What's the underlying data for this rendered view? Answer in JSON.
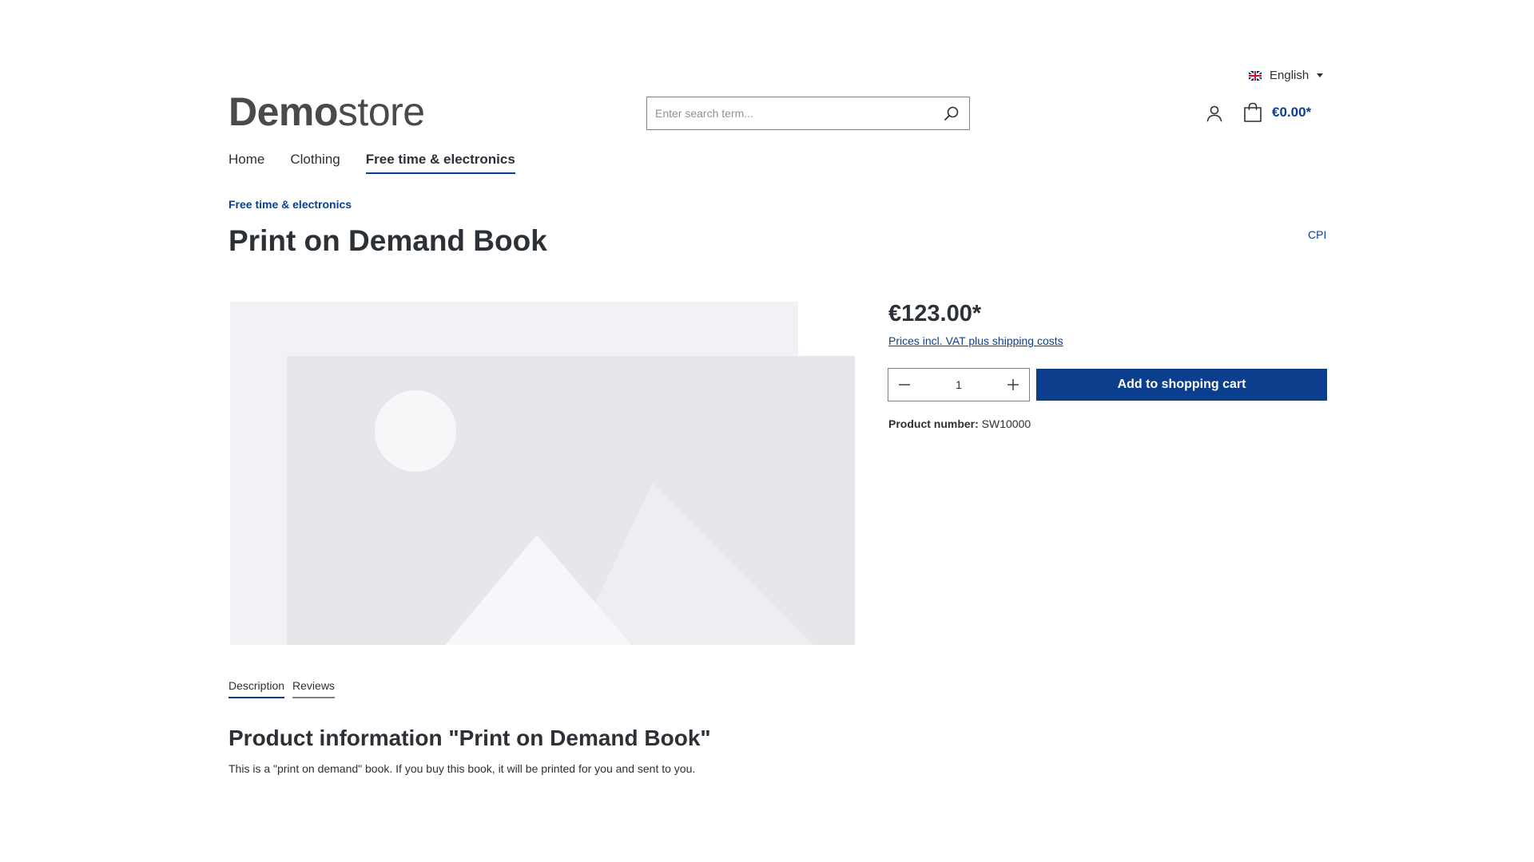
{
  "header": {
    "language": "English",
    "logo": {
      "bold": "Demo",
      "light": "store"
    },
    "search_placeholder": "Enter search term...",
    "cart_total": "€0.00*"
  },
  "nav": {
    "items": [
      {
        "label": "Home"
      },
      {
        "label": "Clothing"
      },
      {
        "label": "Free time & electronics",
        "active": true
      }
    ]
  },
  "product": {
    "breadcrumb": "Free time & electronics",
    "title": "Print on Demand Book",
    "manufacturer_link": "CPI",
    "price": "€123.00*",
    "vat_note": "Prices incl. VAT plus shipping costs",
    "quantity": "1",
    "add_to_cart_label": "Add to shopping cart",
    "product_number_label": "Product number:",
    "product_number_value": "SW10000"
  },
  "tabs": [
    {
      "label": "Description",
      "active": true
    },
    {
      "label": "Reviews"
    }
  ],
  "description": {
    "heading": "Product information \"Print on Demand Book\"",
    "text": "This is a \"print on demand\" book. If you buy this book, it will be printed for you and sent to you."
  },
  "colors": {
    "accent": "#0b3f8e",
    "text": "#2b3136",
    "placeholder_bg": "#f1f2f5"
  }
}
